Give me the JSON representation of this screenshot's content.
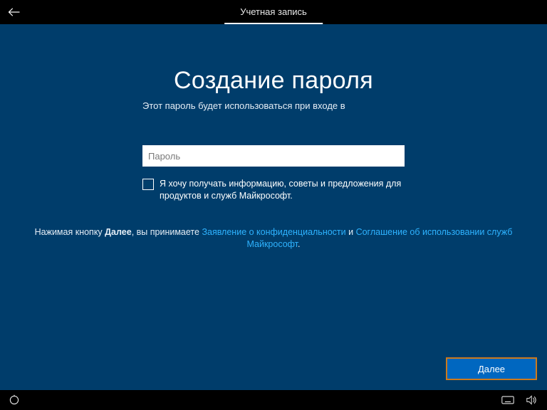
{
  "topbar": {
    "tab": "Учетная запись"
  },
  "page": {
    "title": "Создание пароля",
    "subtitle": "Этот пароль будет использоваться при входе в"
  },
  "form": {
    "password_placeholder": "Пароль",
    "checkbox_label": "Я хочу получать информацию, советы и предложения для продуктов и служб Майкрософт."
  },
  "legal": {
    "prefix": "Нажимая кнопку ",
    "bold_word": "Далее",
    "mid": ", вы принимаете ",
    "privacy_link": "Заявление о конфиденциальности",
    "and": " и ",
    "services_link": "Соглашение об использовании служб Майкрософт",
    "suffix": "."
  },
  "buttons": {
    "next": "Далее"
  }
}
